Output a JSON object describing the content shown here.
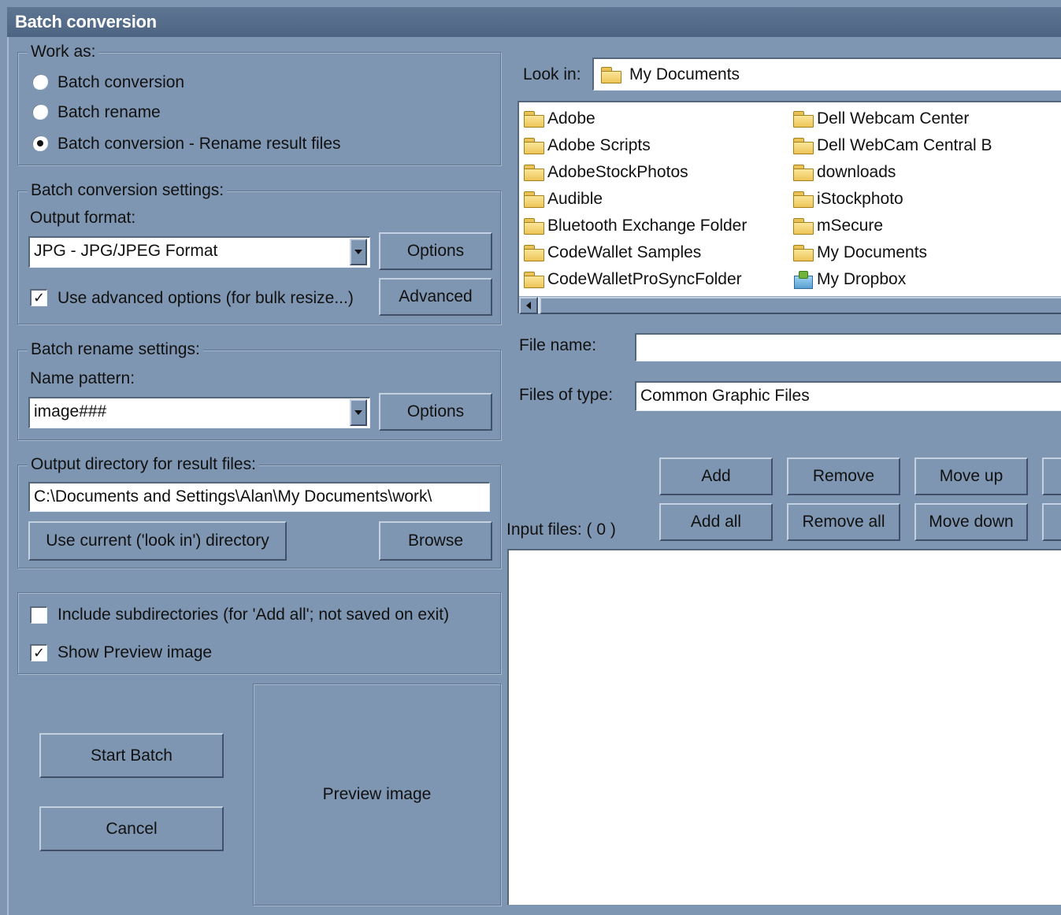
{
  "window": {
    "title": "Batch conversion"
  },
  "work_as": {
    "legend": "Work as:",
    "options": [
      {
        "label": "Batch conversion",
        "selected": false
      },
      {
        "label": "Batch rename",
        "selected": false
      },
      {
        "label": "Batch conversion - Rename result files",
        "selected": true
      }
    ]
  },
  "conversion": {
    "legend": "Batch conversion settings:",
    "output_format_label": "Output format:",
    "output_format_value": "JPG - JPG/JPEG Format",
    "options_button": "Options",
    "advanced_checkbox_label": "Use advanced options (for bulk resize...)",
    "advanced_checked": true,
    "advanced_button": "Advanced"
  },
  "rename": {
    "legend": "Batch rename settings:",
    "name_pattern_label": "Name pattern:",
    "name_pattern_value": "image###",
    "options_button": "Options"
  },
  "output_dir": {
    "legend": "Output directory for result files:",
    "path": "C:\\Documents and Settings\\Alan\\My Documents\\work\\",
    "use_current_button": "Use current ('look in') directory",
    "browse_button": "Browse"
  },
  "misc": {
    "include_subdirs_label": "Include subdirectories (for 'Add all'; not saved on exit)",
    "include_subdirs_checked": false,
    "show_preview_label": "Show Preview image",
    "show_preview_checked": true
  },
  "actions": {
    "start_batch": "Start Batch",
    "cancel": "Cancel"
  },
  "preview": {
    "label": "Preview image"
  },
  "browser": {
    "look_in_label": "Look in:",
    "look_in_value": "My Documents",
    "files_col1": [
      "Adobe",
      "Adobe Scripts",
      "AdobeStockPhotos",
      "Audible",
      "Bluetooth Exchange Folder",
      "CodeWallet Samples",
      "CodeWalletProSyncFolder"
    ],
    "files_col2": [
      "Dell Webcam Center",
      "Dell WebCam Central B",
      "downloads",
      "iStockphoto",
      "mSecure",
      "My Documents",
      "My Dropbox"
    ],
    "file_name_label": "File name:",
    "file_name_value": "",
    "files_of_type_label": "Files of type:",
    "files_of_type_value": "Common Graphic Files"
  },
  "list_buttons": {
    "add": "Add",
    "remove": "Remove",
    "move_up": "Move up",
    "add_all": "Add all",
    "remove_all": "Remove all",
    "move_down": "Move down"
  },
  "input_files": {
    "label": "Input files: ( 0 )"
  }
}
